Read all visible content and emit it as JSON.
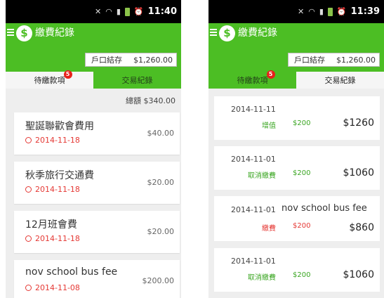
{
  "left_screen": {
    "status": {
      "time": "11:40"
    },
    "app_title": "繳費紀錄",
    "logo_text": "$",
    "balance_label": "戶口結存",
    "balance_value": "$1,260.00",
    "tabs": [
      {
        "label": "待繳款項",
        "badge": "5",
        "active": true
      },
      {
        "label": "交易紀錄",
        "active": false
      }
    ],
    "total_text": "總額 $340.00",
    "items": [
      {
        "title": "聖誕聯歡會費用",
        "date": "2014-11-18",
        "amount": "$40.00"
      },
      {
        "title": "秋季旅行交通費",
        "date": "2014-11-18",
        "amount": "$20.00"
      },
      {
        "title": "12月班會費",
        "date": "2014-11-18",
        "amount": "$20.00"
      },
      {
        "title": "nov school bus fee",
        "date": "2014-11-08",
        "amount": "$200.00"
      }
    ]
  },
  "right_screen": {
    "status": {
      "time": "11:39"
    },
    "app_title": "繳費紀錄",
    "logo_text": "$",
    "balance_label": "戶口結存",
    "balance_value": "$1,260.00",
    "tabs": [
      {
        "label": "待繳款項",
        "badge": "5",
        "active": false
      },
      {
        "label": "交易紀錄",
        "active": true
      }
    ],
    "transactions": [
      {
        "date": "2014-11-11",
        "name": "",
        "type": "增值",
        "type_color": "#3aa622",
        "amount": "$200",
        "amount_color": "#3aa622",
        "balance": "$1260"
      },
      {
        "date": "2014-11-01",
        "name": "",
        "type": "取消繳費",
        "type_color": "#3aa622",
        "amount": "$200",
        "amount_color": "#3aa622",
        "balance": "$1060"
      },
      {
        "date": "2014-11-01",
        "name": "nov school bus fee",
        "type": "繳費",
        "type_color": "#e53935",
        "amount": "$200",
        "amount_color": "#e53935",
        "balance": "$860"
      },
      {
        "date": "2014-11-01",
        "name": "",
        "type": "取消繳費",
        "type_color": "#3aa622",
        "amount": "$200",
        "amount_color": "#3aa622",
        "balance": "$1060"
      }
    ]
  },
  "colors": {
    "brand_green": "#4cbe24",
    "badge_red": "#e8201a",
    "due_red": "#e53935"
  },
  "icons": [
    "mute-icon",
    "wifi-icon",
    "signal-icon",
    "battery-icon",
    "alarm-icon",
    "menu-icon",
    "dollar-logo-icon",
    "clock-icon"
  ]
}
